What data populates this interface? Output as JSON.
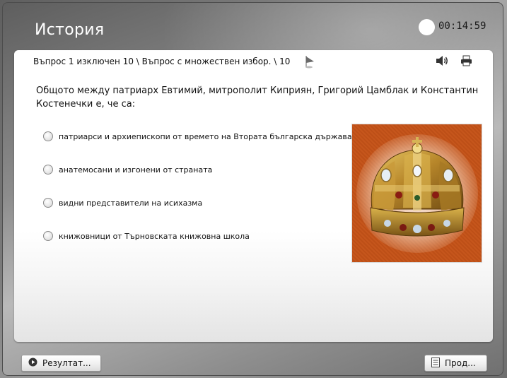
{
  "app": {
    "title": "История",
    "timer": "00:14:59"
  },
  "question_header": {
    "text": "Въпрос 1 изключен 10 \\ Въпрос с множествен избор. \\ 10",
    "icons": [
      "flag-icon",
      "speaker-icon",
      "printer-icon"
    ]
  },
  "question": {
    "text": "Общото между патриарх Евтимий, митрополит Киприян, Григорий Цамблак и Константин Костенечки е, че са:",
    "options": [
      {
        "label": "патриарси и архиепископи от времето на Втората българска държава",
        "selected": false
      },
      {
        "label": "анатемосани и изгонени от страната",
        "selected": false
      },
      {
        "label": "видни представители на исихазма",
        "selected": false
      },
      {
        "label": "книжовници от Търновската книжовна школа",
        "selected": false
      }
    ],
    "image": "crown-mitre-image"
  },
  "footer": {
    "results_label": "Резултат...",
    "next_label": "Прод..."
  },
  "colors": {
    "image_background": "#c6561c",
    "gold": "#c9a23a"
  }
}
